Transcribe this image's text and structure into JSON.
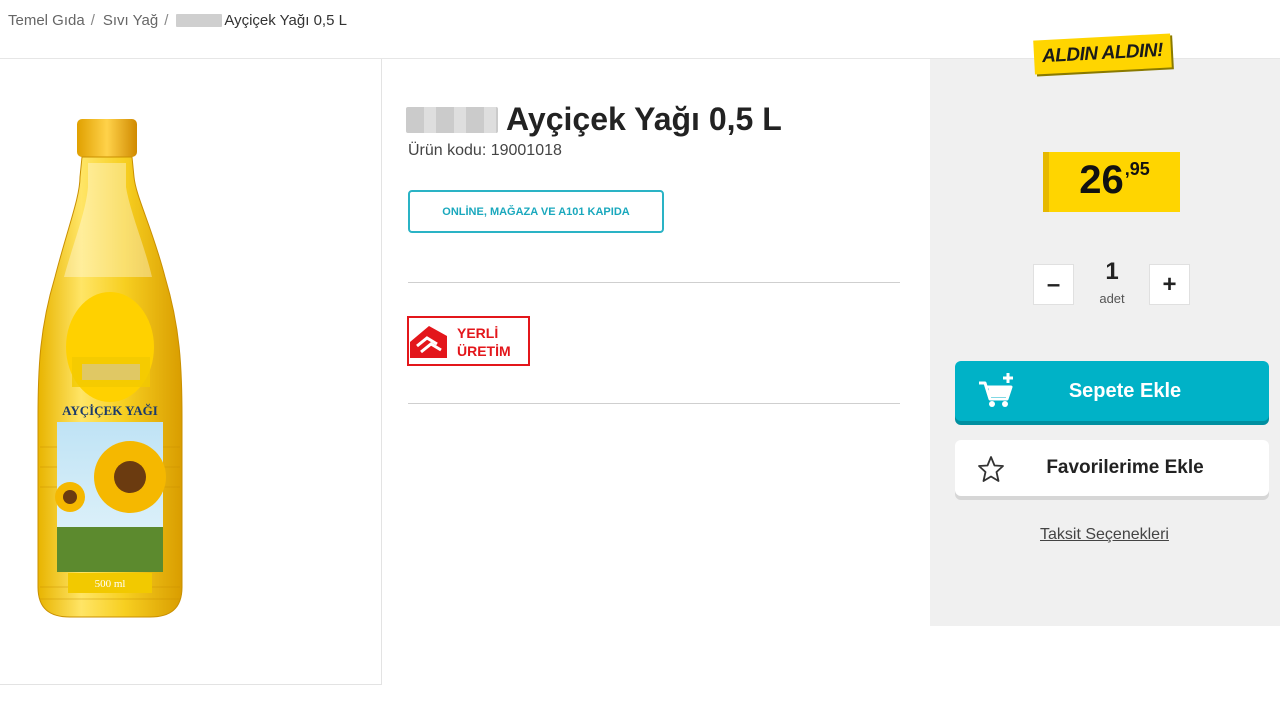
{
  "breadcrumb": {
    "items": [
      "Temel Gıda",
      "Sıvı Yağ"
    ],
    "separator": "/",
    "current": "Ayçiçek Yağı 0,5 L"
  },
  "product": {
    "title": "Ayçiçek Yağı 0,5 L",
    "code_text": "Ürün kodu: 19001018",
    "channel_badge": "ONLİNE, MAĞAZA VE A101 KAPIDA",
    "local_badge": {
      "line1": "YERLİ",
      "line2": "ÜRETİM",
      "color": "#e3161b"
    },
    "bottle_label": "AYÇİÇEK YAĞI",
    "bottle_volume": "500 ml"
  },
  "promo_tag": "ALDIN ALDIN!",
  "price": {
    "main": "26",
    "decimal": ",95",
    "accent": "#ffd500"
  },
  "quantity": {
    "minus": "–",
    "value": "1",
    "unit": "adet",
    "plus": "+"
  },
  "actions": {
    "add_to_cart": "Sepete Ekle",
    "add_to_favorites": "Favorilerime Ekle",
    "installments": "Taksit Seçenekleri",
    "primary_color": "#00b2c7"
  }
}
